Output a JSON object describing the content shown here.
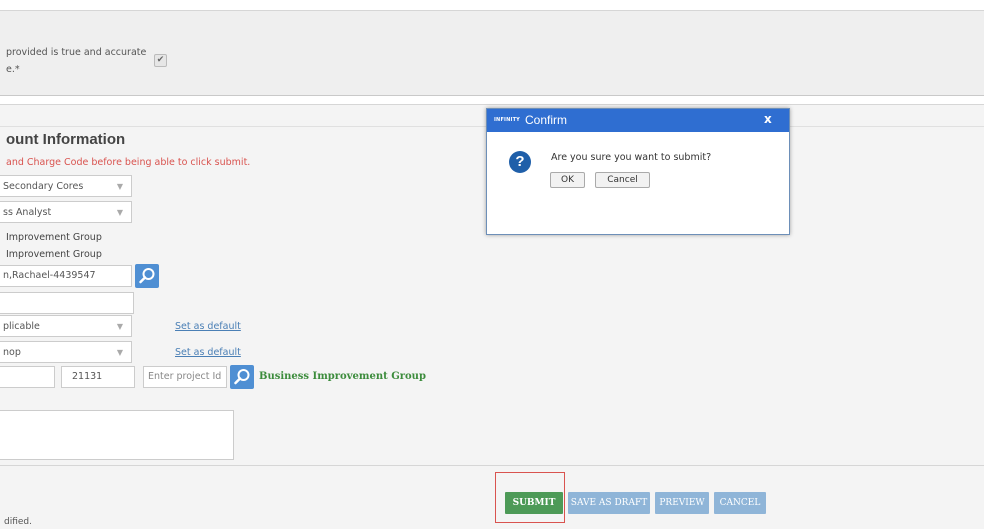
{
  "certification": {
    "line1": "provided is true and accurate",
    "line2": "e.*",
    "checkbox_mark": "✔"
  },
  "account": {
    "title": "ount Information",
    "warning": "and Charge Code before being able to click submit.",
    "select1": "Secondary Cores",
    "select2": "ss Analyst",
    "group1": "Improvement Group",
    "group2": "Improvement Group",
    "person_field": "n,Rachael-4439547",
    "select3": "plicable",
    "select3_link": "Set as default",
    "select4": "nop",
    "select4_link": "Set as default",
    "charge_code": "21131",
    "project_placeholder": "Enter project Id",
    "project_result": "Business Improvement Group"
  },
  "footer": {
    "note": "dified."
  },
  "buttons": {
    "submit": "SUBMIT",
    "save_draft": "SAVE AS DRAFT",
    "preview": "PREVIEW",
    "cancel": "CANCEL"
  },
  "dialog": {
    "brand": "INFINITY",
    "title": "Confirm",
    "close": "x",
    "icon": "question-icon",
    "message": "Are you sure you want to submit?",
    "ok": "OK",
    "cancel": "Cancel"
  },
  "colors": {
    "dialog_header": "#2f6ed1",
    "submit_button": "#4d9a57",
    "secondary_button": "#8fb5d8",
    "warning_text": "#d9534f",
    "link": "#4a7fb5",
    "highlight_border": "#d9534f"
  }
}
